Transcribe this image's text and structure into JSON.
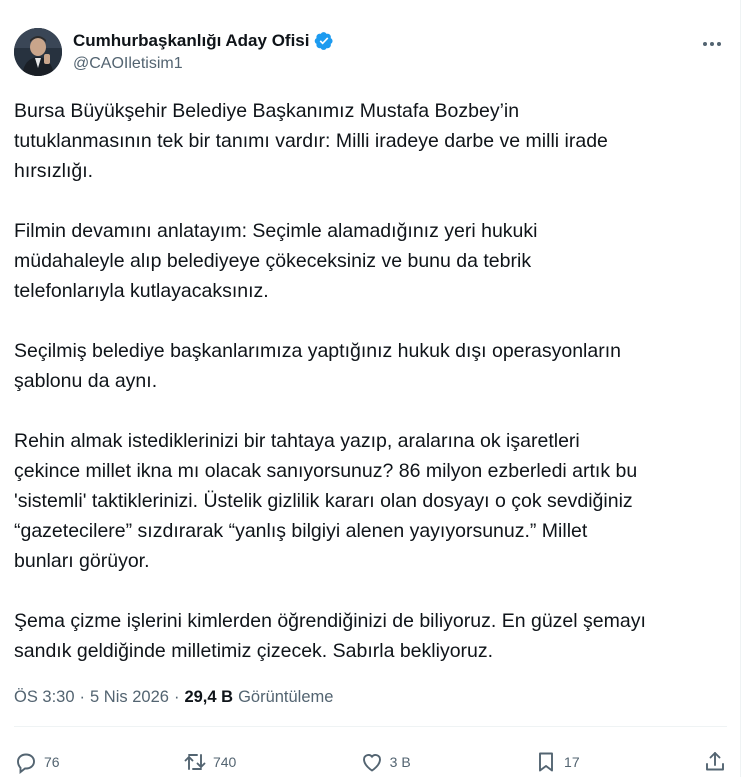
{
  "author": {
    "display_name": "Cumhurbaşkanlığı Aday Ofisi",
    "handle": "@CAOIletisim1",
    "verified": true
  },
  "paragraphs": [
    "Bursa Büyükşehir Belediye Başkanımız Mustafa Bozbey’in\ntutuklanmasının tek bir tanımı vardır: Milli iradeye darbe ve milli irade\nhırsızlığı.",
    "Filmin devamını anlatayım: Seçimle alamadığınız yeri hukuki\nmüdahaleyle alıp belediyeye çökeceksiniz ve bunu da tebrik\ntelefonlarıyla kutlayacaksınız.",
    "Seçilmiş belediye başkanlarımıza yaptığınız hukuk dışı operasyonların\nşablonu da aynı.",
    "Rehin almak istediklerinizi bir tahtaya yazıp, aralarına ok işaretleri\nçekince millet ikna mı olacak sanıyorsunuz? 86 milyon ezberledi artık bu\n'sistemli' taktiklerinizi. Üstelik gizlilik kararı olan dosyayı o çok sevdiğiniz\n“gazetecilere” sızdırarak “yanlış bilgiyi alenen yayıyorsunuz.” Millet\nbunları görüyor.",
    "Şema çizme işlerini kimlerden öğrendiğinizi de biliyoruz. En güzel şemayı\nsandık geldiğinde milletimiz çizecek. Sabırla bekliyoruz."
  ],
  "meta": {
    "time": "ÖS 3:30",
    "separator": "·",
    "date": "5 Nis 2026",
    "views_count": "29,4 B",
    "views_label": "Görüntüleme"
  },
  "actions": {
    "replies": "76",
    "reposts": "740",
    "likes": "3 B",
    "bookmarks": "17"
  },
  "colors": {
    "text": "#0f1419",
    "secondary": "#536471",
    "verified": "#1d9bf0",
    "border": "#eff3f4"
  }
}
